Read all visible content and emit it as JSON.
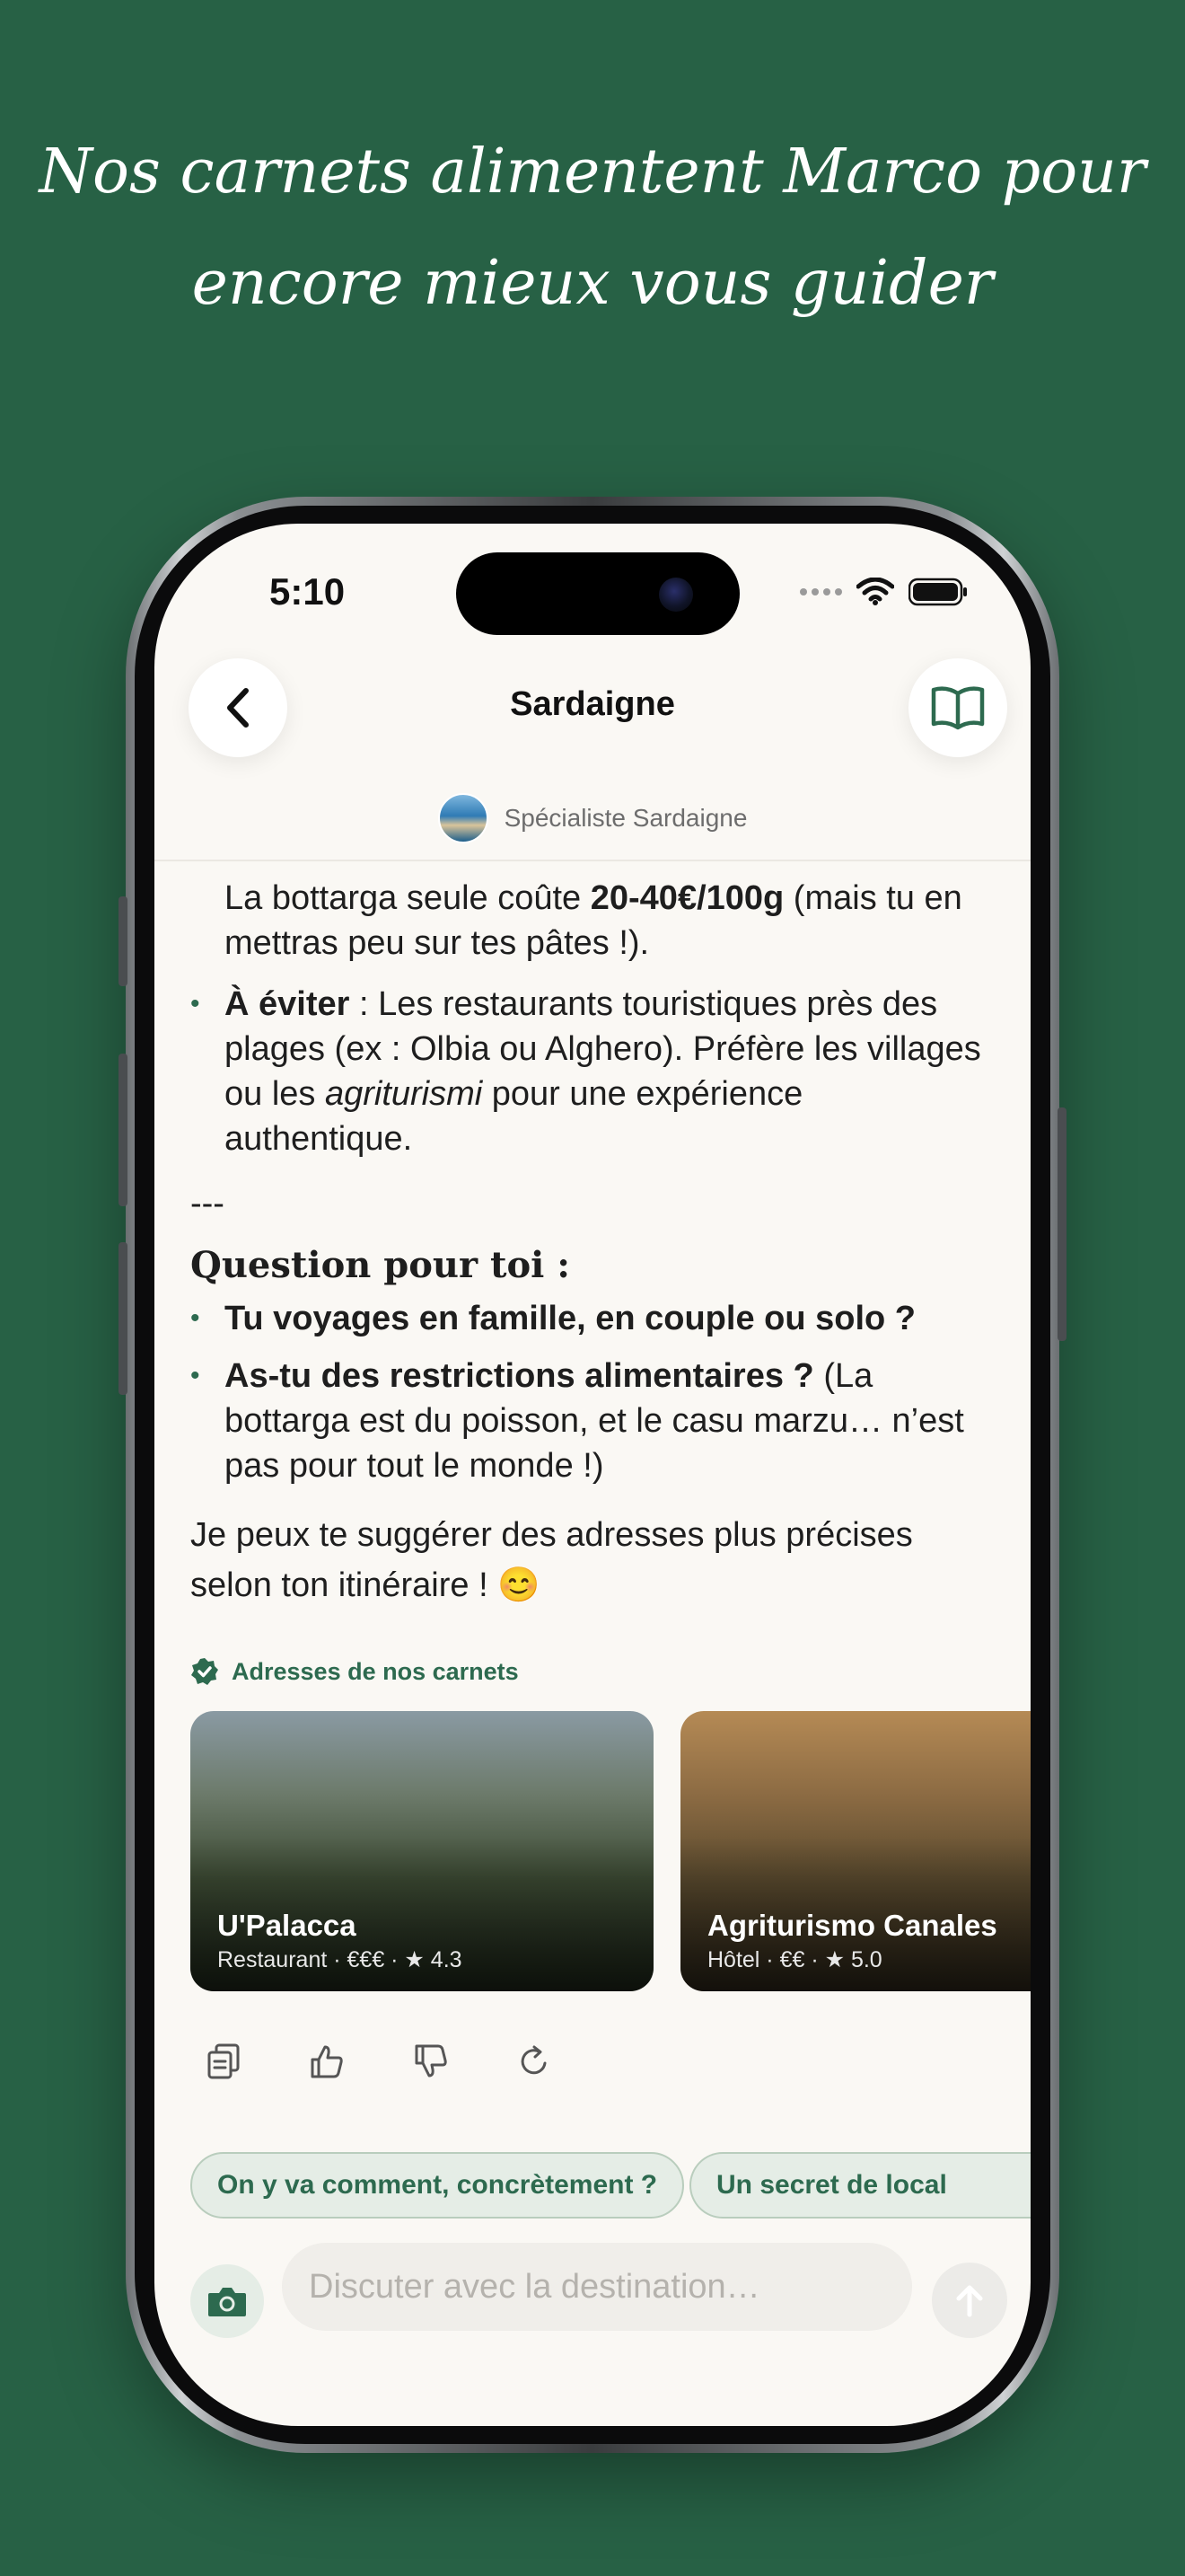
{
  "promo": {
    "line1": "Nos carnets alimentent Marco pour",
    "line2": "encore mieux vous guider"
  },
  "status_bar": {
    "time": "5:10"
  },
  "header": {
    "title": "Sardaigne",
    "back_icon": "chevron-left-icon",
    "carnet_icon": "open-book-icon"
  },
  "specialist": {
    "label": "Spécialiste Sardaigne"
  },
  "message": {
    "p1_a": "La bottarga seule coûte ",
    "p1_b": "20-40€/100g",
    "p1_c": " (mais tu en mettras peu sur tes pâtes !).",
    "b1_bold": "À éviter",
    "b1_a": " : Les restaurants touristiques près des plages (ex : Olbia ou Alghero). Préfère les villages ou les ",
    "b1_italic": "agriturismi",
    "b1_b": " pour une expérience authentique.",
    "separator": "---",
    "question_heading": "Question pour toi :",
    "q1": "Tu voyages en famille, en couple ou solo ?",
    "q2_bold": "As-tu des restrictions alimentaires ?",
    "q2_rest": " (La bottarga est du poisson, et le casu marzu… n’est pas pour tout le monde !)",
    "closing": "Je peux te suggérer des adresses plus précises selon ton itinéraire ! 😊"
  },
  "carnets": {
    "label": "Adresses de nos carnets",
    "cards": [
      {
        "name": "U'Palacca",
        "meta": "Restaurant · €€€ · ★ 4.3"
      },
      {
        "name": "Agriturismo Canales",
        "meta": "Hôtel · €€ · ★ 5.0"
      }
    ]
  },
  "actions": [
    "copy-icon",
    "thumbs-up-icon",
    "thumbs-down-icon",
    "refresh-icon"
  ],
  "suggestions": [
    {
      "label": "On y va comment, concrètement ?"
    },
    {
      "label": "Un secret de local"
    }
  ],
  "composer": {
    "placeholder": "Discuter avec la destination…"
  },
  "colors": {
    "background": "#276145",
    "accent": "#2d6a4f",
    "screen": "#faf8f4"
  }
}
